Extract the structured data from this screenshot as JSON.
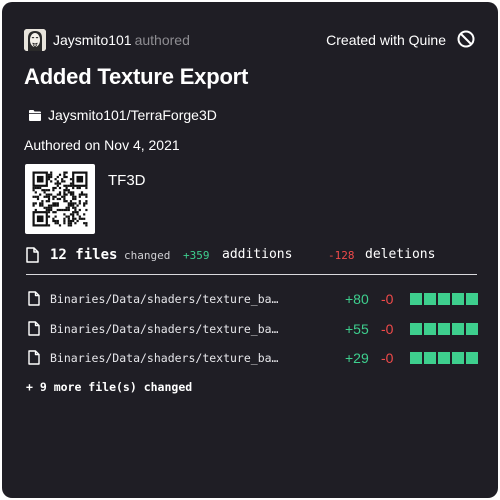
{
  "header": {
    "author_name": "Jaysmito101",
    "author_verb": "authored",
    "created_with": "Created with Quine",
    "avatar_icon": "masked-face-avatar",
    "quine_icon": "no-symbol-icon"
  },
  "title": "Added Texture Export",
  "repo": {
    "icon": "folder-icon",
    "name": "Jaysmito101/TerraForge3D"
  },
  "authored_on": "Authored on Nov 4, 2021",
  "tag": "TF3D",
  "summary": {
    "files": "12 files",
    "changed": "changed",
    "additions_count": "+359",
    "additions_label": "additions",
    "deletions_count": "-128",
    "deletions_label": "deletions"
  },
  "files": [
    {
      "path": "Binaries/Data/shaders/texture_ba…",
      "additions": "+80",
      "deletions": "-0",
      "bar_fraction": 1.0
    },
    {
      "path": "Binaries/Data/shaders/texture_ba…",
      "additions": "+55",
      "deletions": "-0",
      "bar_fraction": 1.0
    },
    {
      "path": "Binaries/Data/shaders/texture_ba…",
      "additions": "+29",
      "deletions": "-0",
      "bar_fraction": 1.0
    }
  ],
  "more": "+ 9 more file(s) changed",
  "colors": {
    "background": "#1f1e25",
    "addition": "#3ecf8e",
    "deletion": "#f04a4a"
  }
}
